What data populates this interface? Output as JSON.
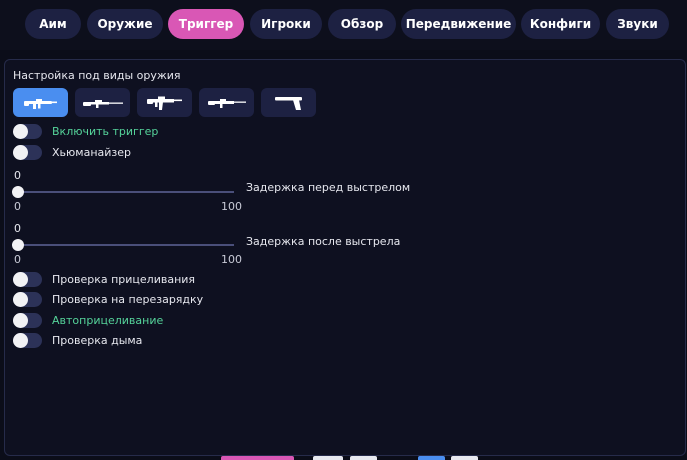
{
  "tabs": [
    {
      "label": "Аим",
      "active": false
    },
    {
      "label": "Оружие",
      "active": false
    },
    {
      "label": "Триггер",
      "active": true
    },
    {
      "label": "Игроки",
      "active": false
    },
    {
      "label": "Обзор",
      "active": false
    },
    {
      "label": "Передвижение",
      "active": false
    },
    {
      "label": "Конфиги",
      "active": false
    },
    {
      "label": "Звуки",
      "active": false
    }
  ],
  "section": {
    "title": "Настройка под виды оружия"
  },
  "weapons": [
    {
      "icon": "rifle-icon",
      "active": true
    },
    {
      "icon": "sniper-rifle-icon",
      "active": false
    },
    {
      "icon": "assault-rifle-icon",
      "active": false
    },
    {
      "icon": "smg-icon",
      "active": false
    },
    {
      "icon": "pistol-icon",
      "active": false
    }
  ],
  "toggles_top": [
    {
      "label": "Включить триггер",
      "enabled": false,
      "highlight": true
    },
    {
      "label": "Хьюманайзер",
      "enabled": false,
      "highlight": false
    }
  ],
  "sliders": [
    {
      "label": "Задержка перед выстрелом",
      "value": "0",
      "min": "0",
      "max": "100"
    },
    {
      "label": "Задержка после выстрела",
      "value": "0",
      "min": "0",
      "max": "100"
    }
  ],
  "toggles_bottom": [
    {
      "label": "Проверка прицеливания",
      "enabled": false,
      "highlight": false
    },
    {
      "label": "Проверка на перезарядку",
      "enabled": false,
      "highlight": false
    },
    {
      "label": "Автоприцеливание",
      "enabled": false,
      "highlight": true
    },
    {
      "label": "Проверка дыма",
      "enabled": false,
      "highlight": false
    }
  ],
  "colors": {
    "accent_pink": "#d957b5",
    "accent_blue": "#4a8ef0",
    "highlight_green": "#55d39a",
    "tab_bg": "#1d2142"
  }
}
